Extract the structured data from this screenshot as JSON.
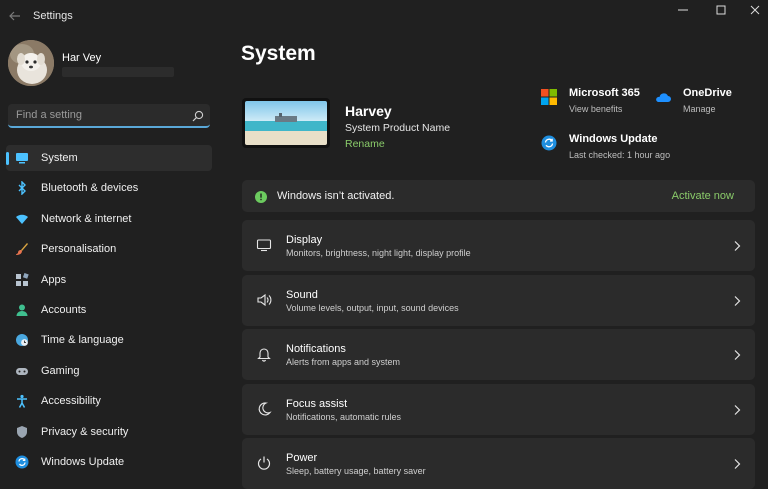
{
  "window": {
    "title": "Settings",
    "back_icon": "back-arrow-icon",
    "controls": [
      "minimize-icon",
      "maximize-icon",
      "close-icon"
    ]
  },
  "profile": {
    "name": "Har Vey"
  },
  "search": {
    "placeholder": "Find a setting",
    "value": "",
    "icon": "search-icon"
  },
  "sidebar": {
    "items": [
      {
        "label": "System",
        "icon": "monitor-icon",
        "active": true
      },
      {
        "label": "Bluetooth & devices",
        "icon": "bluetooth-icon"
      },
      {
        "label": "Network & internet",
        "icon": "wifi-icon"
      },
      {
        "label": "Personalisation",
        "icon": "brush-icon"
      },
      {
        "label": "Apps",
        "icon": "apps-icon"
      },
      {
        "label": "Accounts",
        "icon": "person-icon"
      },
      {
        "label": "Time & language",
        "icon": "globe-clock-icon"
      },
      {
        "label": "Gaming",
        "icon": "gamepad-icon"
      },
      {
        "label": "Accessibility",
        "icon": "accessibility-icon"
      },
      {
        "label": "Privacy & security",
        "icon": "shield-icon"
      },
      {
        "label": "Windows Update",
        "icon": "sync-icon"
      }
    ]
  },
  "main": {
    "title": "System",
    "device": {
      "name": "Harvey",
      "model": "System Product Name",
      "rename_label": "Rename"
    },
    "quick_links": [
      {
        "title": "Microsoft 365",
        "subtitle": "View benefits",
        "icon": "microsoft-logo-icon"
      },
      {
        "title": "OneDrive",
        "subtitle": "Manage",
        "icon": "onedrive-cloud-icon"
      },
      {
        "title": "Windows Update",
        "subtitle": "Last checked: 1 hour ago",
        "icon": "windows-update-icon"
      }
    ],
    "activation": {
      "text": "Windows isn’t activated.",
      "action_label": "Activate now",
      "icon": "warning-info-icon"
    },
    "settings": [
      {
        "title": "Display",
        "subtitle": "Monitors, brightness, night light, display profile",
        "icon": "display-icon"
      },
      {
        "title": "Sound",
        "subtitle": "Volume levels, output, input, sound devices",
        "icon": "speaker-icon"
      },
      {
        "title": "Notifications",
        "subtitle": "Alerts from apps and system",
        "icon": "bell-icon"
      },
      {
        "title": "Focus assist",
        "subtitle": "Notifications, automatic rules",
        "icon": "moon-icon"
      },
      {
        "title": "Power",
        "subtitle": "Sleep, battery usage, battery saver",
        "icon": "power-icon"
      }
    ]
  },
  "colors": {
    "background": "#202020",
    "card": "#2b2b2b",
    "accent": "#4cc2ff",
    "link_green": "#8acb6a"
  }
}
